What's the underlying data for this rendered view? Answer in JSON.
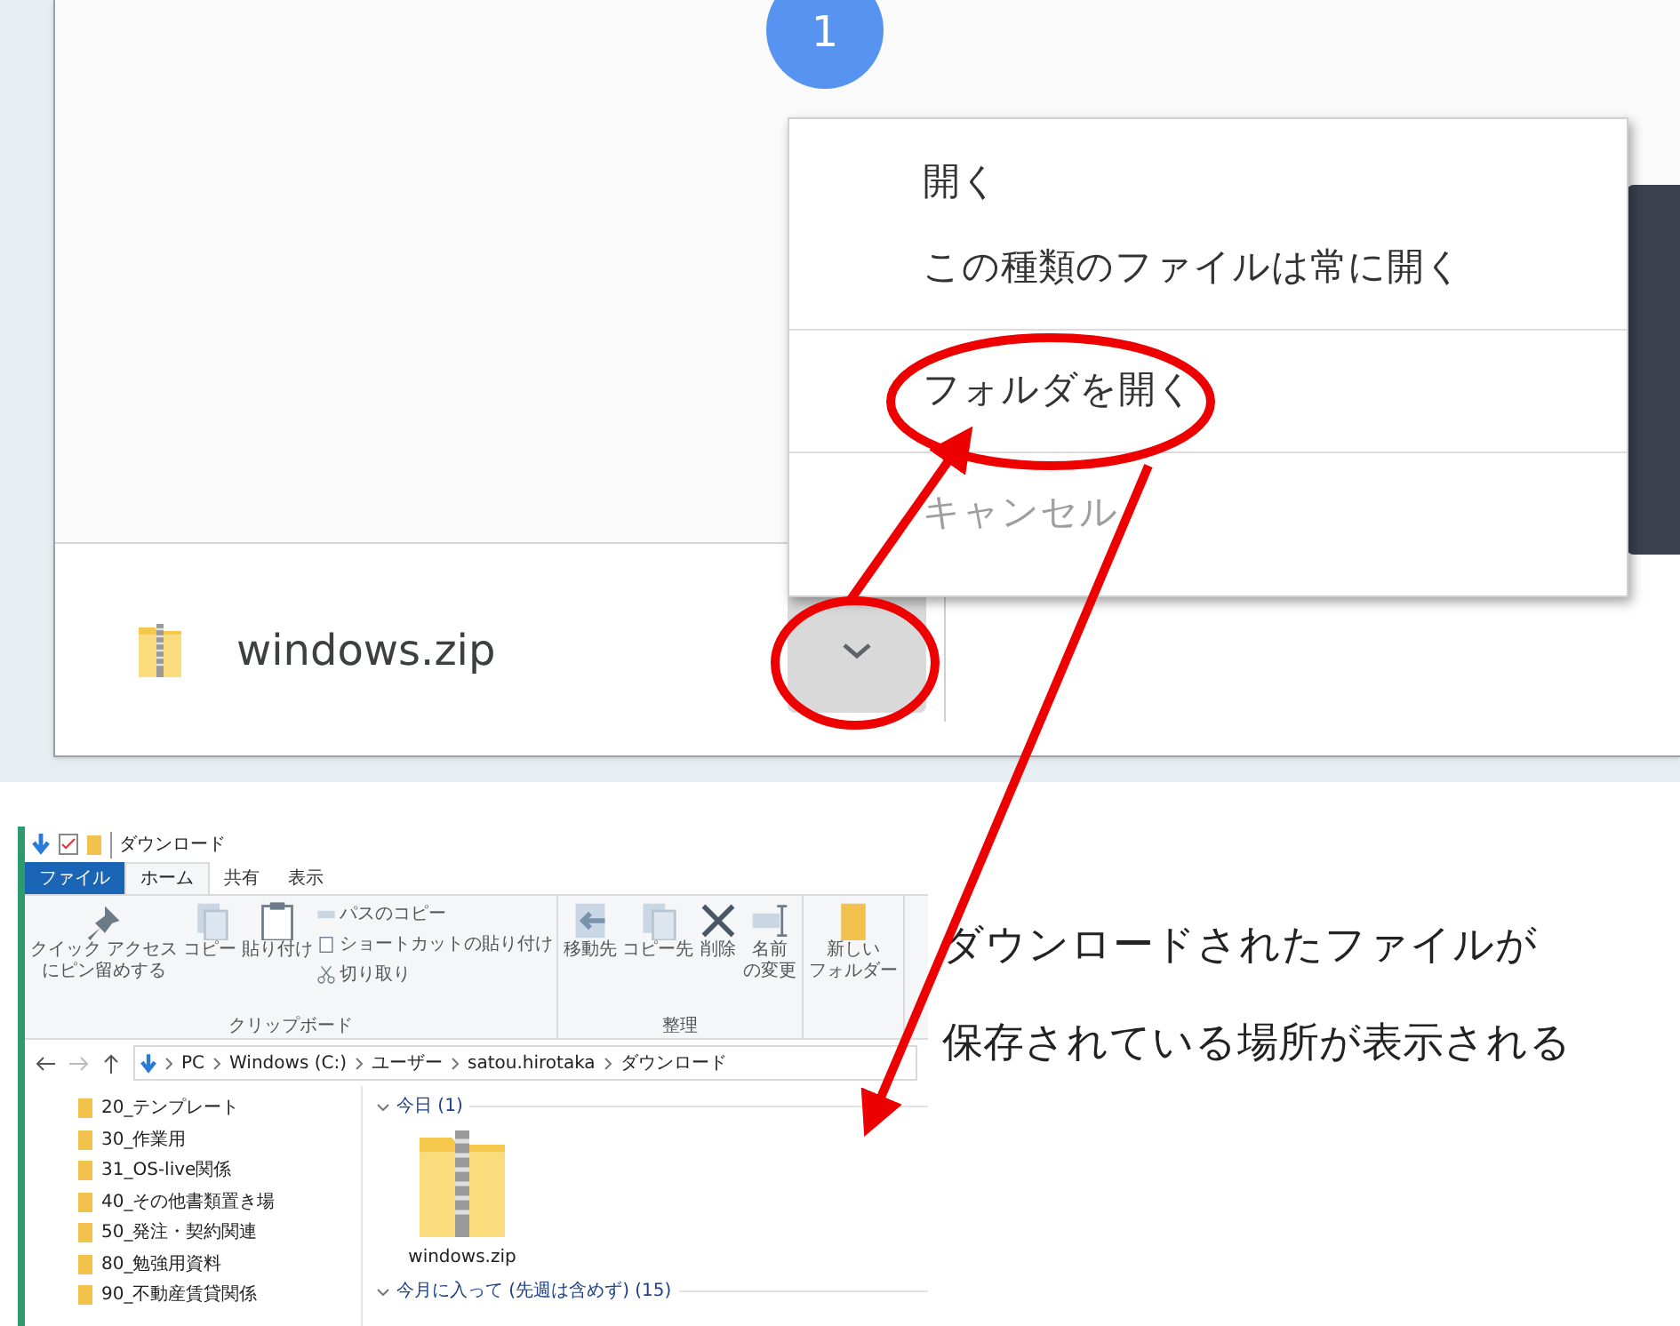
{
  "browser": {
    "badge": "1",
    "download": {
      "filename": "windows.zip"
    },
    "menu": {
      "groups": [
        [
          {
            "label": "開く",
            "disabled": false
          },
          {
            "label": "この種類のファイルは常に開く",
            "disabled": false
          }
        ],
        [
          {
            "label": "フォルダを開く",
            "disabled": false
          }
        ],
        [
          {
            "label": "キャンセル",
            "disabled": true
          }
        ]
      ]
    }
  },
  "explorer": {
    "title": "ダウンロード",
    "tabs": [
      {
        "label": "ファイル",
        "kind": "file",
        "selected": false
      },
      {
        "label": "ホーム",
        "kind": "tab",
        "selected": true
      },
      {
        "label": "共有",
        "kind": "tab",
        "selected": false
      },
      {
        "label": "表示",
        "kind": "tab",
        "selected": false
      }
    ],
    "ribbon": {
      "groups": [
        {
          "label": "クリップボード",
          "large": [
            {
              "kind": "pin",
              "lines": [
                "クイック アクセス",
                "にピン留めする"
              ]
            },
            {
              "kind": "copy",
              "lines": [
                "コピー"
              ]
            },
            {
              "kind": "paste",
              "lines": [
                "貼り付け"
              ]
            }
          ],
          "small": [
            {
              "kind": "path",
              "label": "パスのコピー"
            },
            {
              "kind": "shortcut",
              "label": "ショートカットの貼り付け"
            },
            {
              "kind": "cut",
              "label": "切り取り"
            }
          ]
        },
        {
          "label": "整理",
          "large": [
            {
              "kind": "move",
              "lines": [
                "移動先"
              ]
            },
            {
              "kind": "copyto",
              "lines": [
                "コピー先"
              ]
            },
            {
              "kind": "delete",
              "lines": [
                "削除"
              ]
            },
            {
              "kind": "rename",
              "lines": [
                "名前",
                "の変更"
              ]
            }
          ]
        },
        {
          "large": [
            {
              "kind": "folder",
              "lines": [
                "新しい",
                "フォルダー"
              ]
            }
          ]
        }
      ]
    },
    "address": [
      "PC",
      "Windows (C:)",
      "ユーザー",
      "satou.hirotaka",
      "ダウンロード"
    ],
    "tree": [
      "20_テンプレート",
      "30_作業用",
      "31_OS-live関係",
      "40_その他書類置き場",
      "50_発注・契約関連",
      "80_勉強用資料",
      "90_不動産賃貸関係"
    ],
    "sections": [
      {
        "header": "今日 (1)",
        "files": [
          "windows.zip"
        ]
      },
      {
        "header": "今月に入って (先週は含めず) (15)"
      }
    ]
  },
  "annotation": [
    "ダウンロードされたファイルが",
    "保存されている場所が表示される"
  ]
}
